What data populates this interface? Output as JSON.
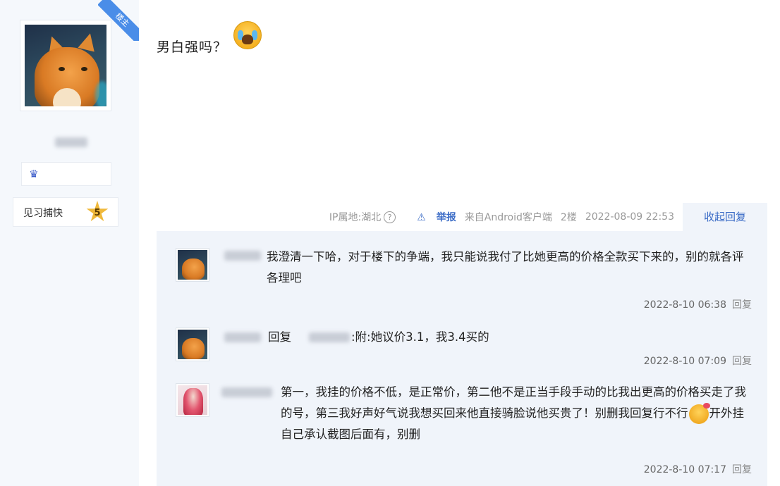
{
  "sidebar": {
    "host_badge": "楼主",
    "forum_level_name": "见习捕快",
    "forum_level_num": "5"
  },
  "post": {
    "content": "男白强吗？",
    "meta": {
      "ip_location": "IP属地:湖北",
      "report": "举报",
      "client": "来自Android客户端",
      "floor": "2楼",
      "time": "2022-08-09 22:53"
    },
    "collapse_label": "收起回复"
  },
  "replies": [
    {
      "text": "我澄清一下哈，对于楼下的争端，我只能说我付了比她更高的价格全款买下来的，别的就各评各理吧",
      "time": "2022-8-10 06:38",
      "reply_label": "回复"
    },
    {
      "reply_prefix": "回复",
      "text": ":附:她议价3.1，我3.4买的",
      "time": "2022-8-10 07:09",
      "reply_label": "回复"
    },
    {
      "text_a": "第一，我挂的价格不低，是正常价，第二他不是正当手段手动的比我出更高的价格买走了我的号，第三我好声好气说我想买回来他直接骑脸说他买贵了！别删我回复行不行",
      "text_b": "开外挂自己承认截图后面有，别删",
      "time": "2022-8-10 07:17",
      "reply_label": "回复"
    }
  ]
}
